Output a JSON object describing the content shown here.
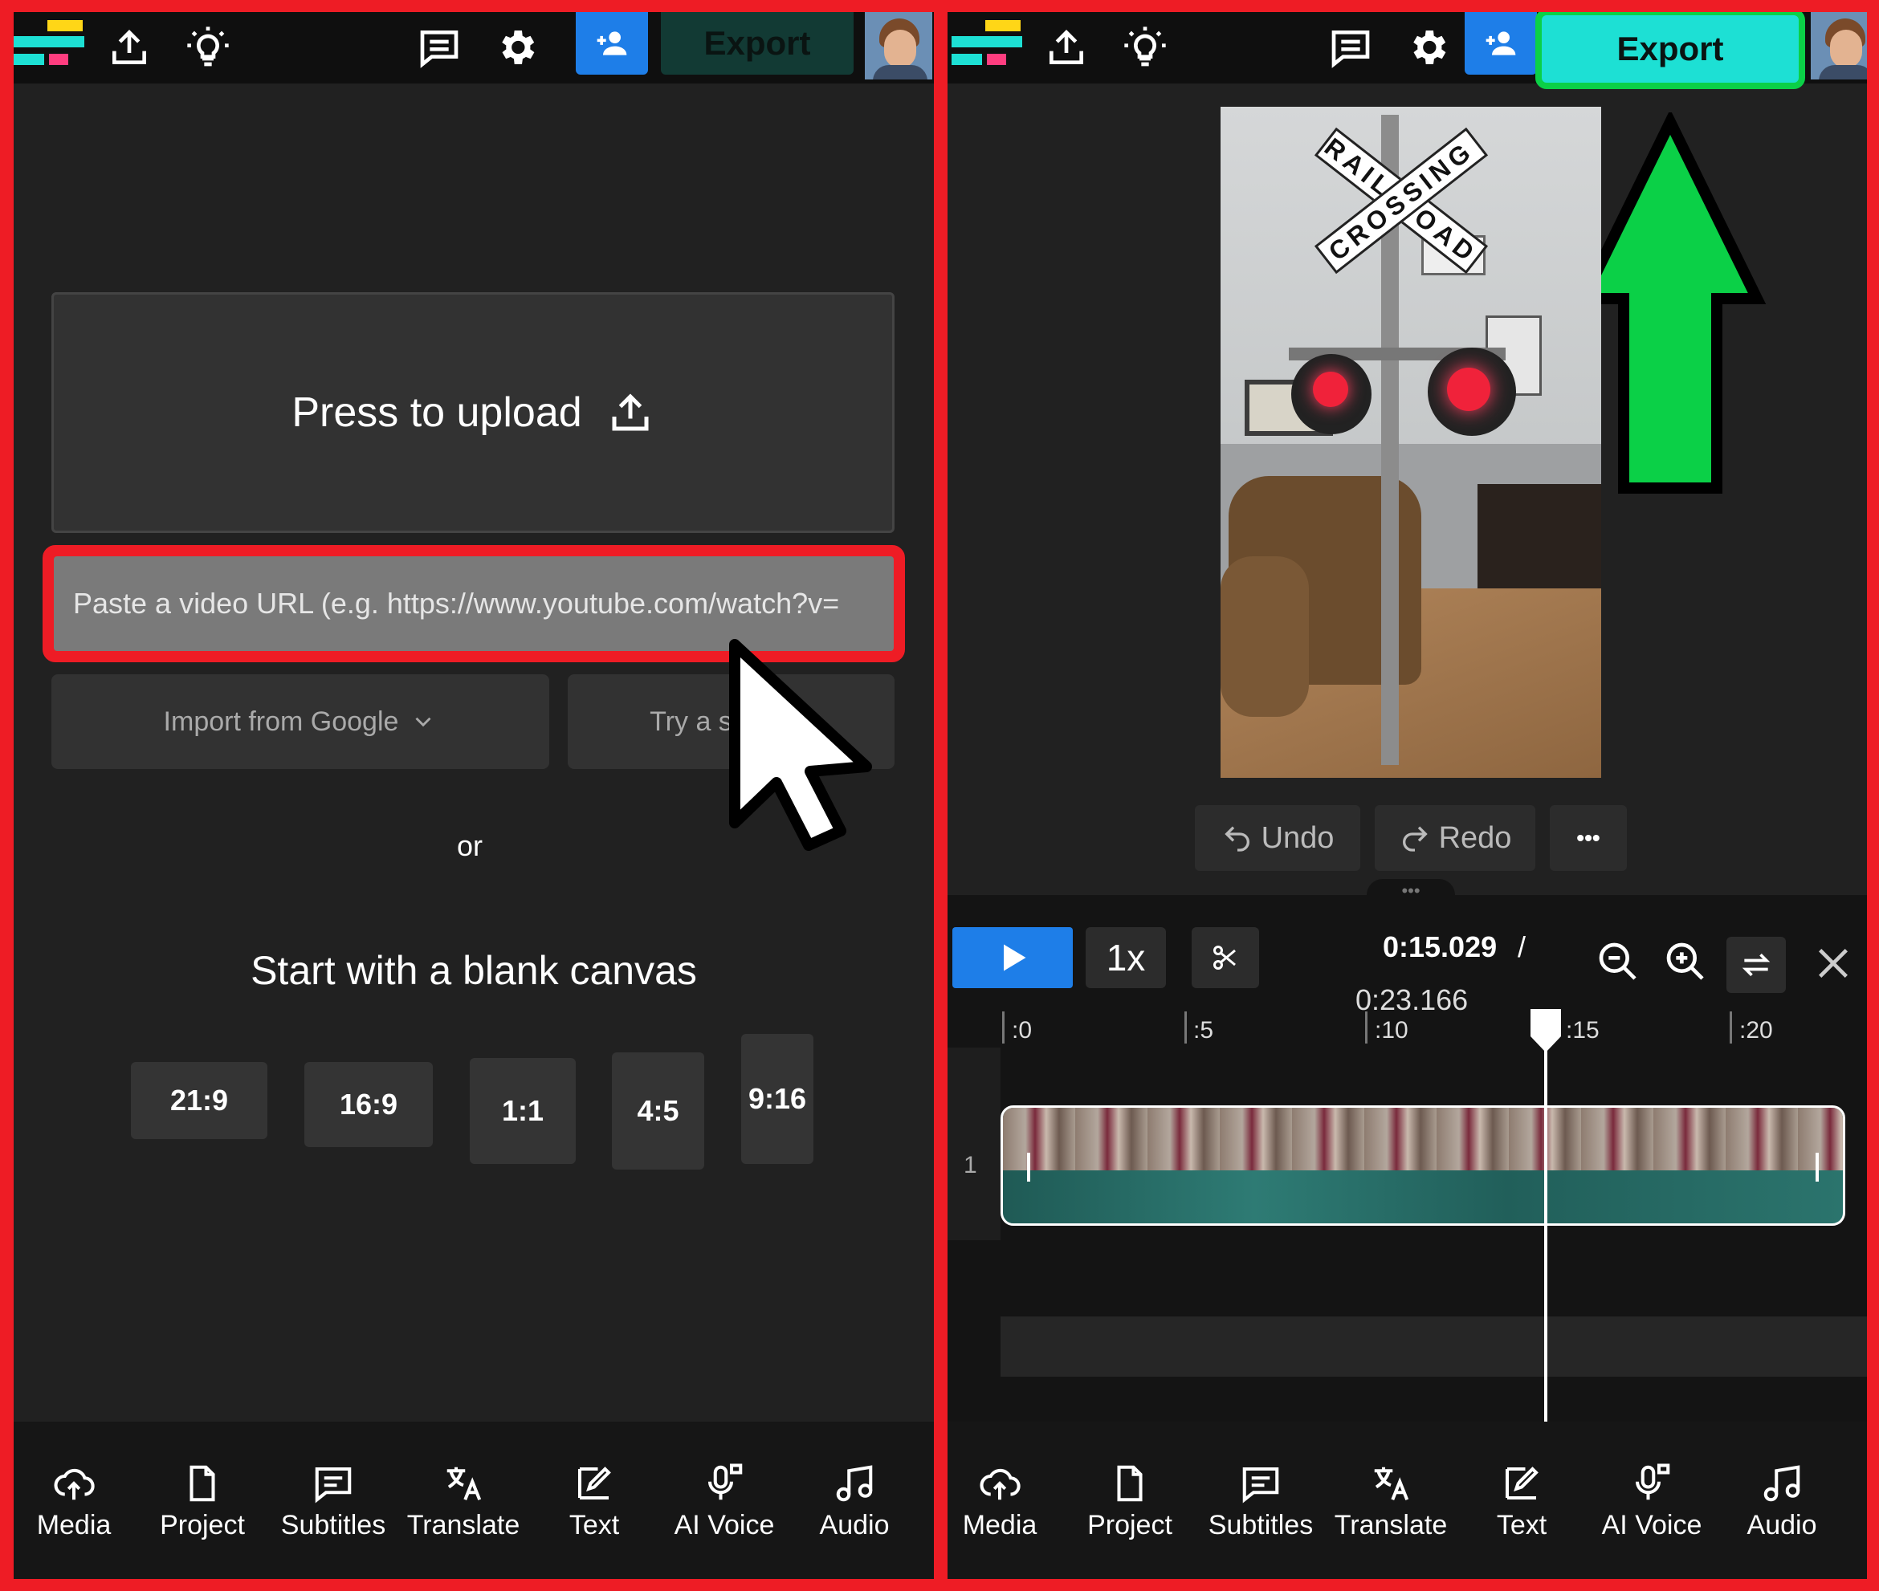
{
  "left": {
    "topbar": {
      "export_label": "Export"
    },
    "upload": {
      "label": "Press to upload"
    },
    "url": {
      "placeholder": "Paste a video URL (e.g. https://www.youtube.com/watch?v="
    },
    "import_label": "Import from Google",
    "try_label": "Try a s",
    "or_label": "or",
    "blank_title": "Start with a blank canvas",
    "ratios": [
      "21:9",
      "16:9",
      "1:1",
      "4:5",
      "9:16"
    ]
  },
  "right": {
    "topbar": {
      "export_label": "Export"
    },
    "preview_text": {
      "sign_top": "RAIL ROAD",
      "sign_bottom": "CROSSING"
    },
    "undo_label": "Undo",
    "redo_label": "Redo",
    "more_label": "•••",
    "speed_label": "1x",
    "current_time": "0:15.029",
    "time_sep": "/",
    "total_time": "0:23.166",
    "ruler": [
      ":0",
      ":5",
      ":10",
      ":15",
      ":20"
    ],
    "track_number": "1"
  },
  "nav": [
    "Media",
    "Project",
    "Subtitles",
    "Translate",
    "Text",
    "AI Voice",
    "Audio"
  ],
  "colors": {
    "border": "#ee1c25",
    "share": "#1e7ee8",
    "export_active": "#1de0d4",
    "export_dim": "#123a34",
    "highlight_green": "#0bd047",
    "play": "#1e7ee8"
  }
}
